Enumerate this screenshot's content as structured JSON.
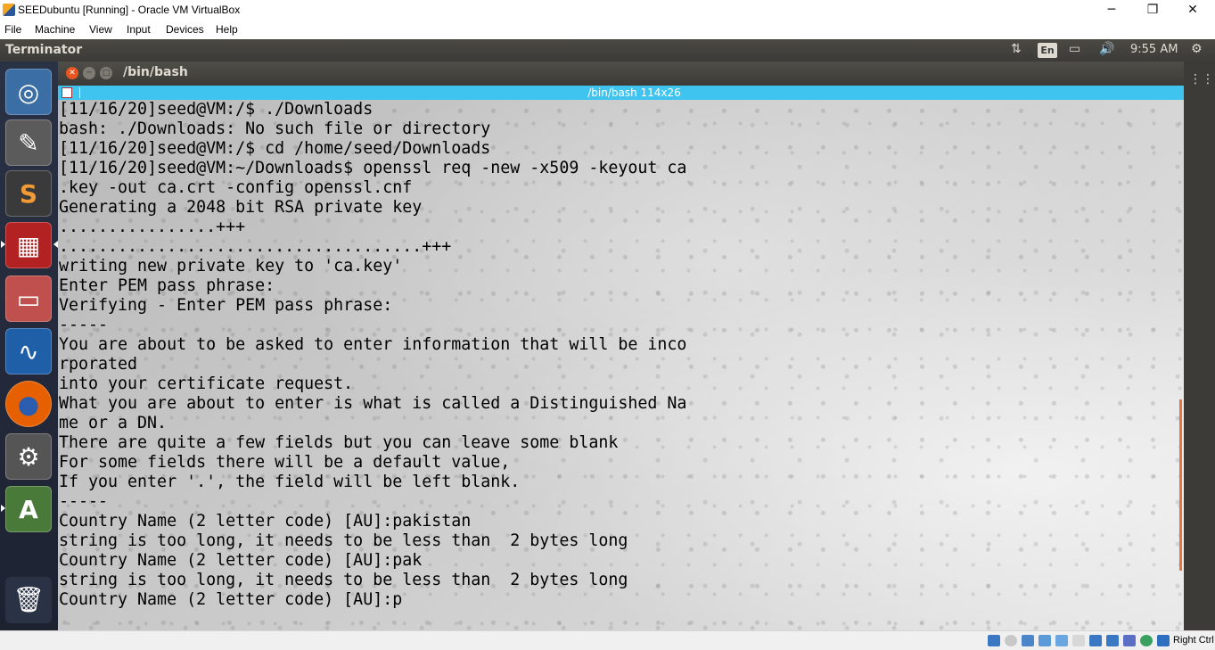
{
  "host_window": {
    "title": "SEEDubuntu [Running] - Oracle VM VirtualBox",
    "controls": {
      "minimize": "─",
      "maximize": "❐",
      "close": "✕"
    }
  },
  "host_menu": [
    "File",
    "Machine",
    "View",
    "Input",
    "Devices",
    "Help"
  ],
  "ubuntu_panel": {
    "app_name": "Terminator",
    "keyboard_layout": "En",
    "clock": "9:55 AM",
    "icons": [
      "network-transfer-icon",
      "battery-icon",
      "volume-icon",
      "settings-gear-icon"
    ]
  },
  "launcher": {
    "items": [
      {
        "name": "ubuntu-dash-icon",
        "glyph": "◎",
        "bg": "#3b6ea5"
      },
      {
        "name": "text-editor-icon",
        "glyph": "✎",
        "bg": "#5b5b5b"
      },
      {
        "name": "sublime-text-icon",
        "glyph": "S",
        "bg": "#3a3a3a"
      },
      {
        "name": "terminator-icon",
        "glyph": "▦",
        "bg": "#b22222"
      },
      {
        "name": "file-manager-icon",
        "glyph": "▭",
        "bg": "#c0504d"
      },
      {
        "name": "wireshark-icon",
        "glyph": "∿",
        "bg": "#1f5fa8"
      },
      {
        "name": "firefox-icon",
        "glyph": "●",
        "bg": "#e66000"
      },
      {
        "name": "system-settings-icon",
        "glyph": "⚙",
        "bg": "#555555"
      },
      {
        "name": "software-updater-icon",
        "glyph": "A",
        "bg": "#4a7a3a"
      },
      {
        "name": "trash-icon",
        "glyph": "🗑",
        "bg": "#2a3246"
      }
    ]
  },
  "terminal": {
    "window_title": "/bin/bash",
    "tab_title": "/bin/bash 114x26",
    "lines": [
      "[11/16/20]seed@VM:/$ ./Downloads",
      "bash: ./Downloads: No such file or directory",
      "[11/16/20]seed@VM:/$ cd /home/seed/Downloads",
      "[11/16/20]seed@VM:~/Downloads$ openssl req -new -x509 -keyout ca",
      ".key -out ca.crt -config openssl.cnf",
      "Generating a 2048 bit RSA private key",
      "................+++",
      ".....................................+++",
      "writing new private key to 'ca.key'",
      "Enter PEM pass phrase:",
      "Verifying - Enter PEM pass phrase:",
      "-----",
      "You are about to be asked to enter information that will be inco",
      "rporated",
      "into your certificate request.",
      "What you are about to enter is what is called a Distinguished Na",
      "me or a DN.",
      "There are quite a few fields but you can leave some blank",
      "For some fields there will be a default value,",
      "If you enter '.', the field will be left blank.",
      "-----",
      "Country Name (2 letter code) [AU]:pakistan",
      "string is too long, it needs to be less than  2 bytes long",
      "Country Name (2 letter code) [AU]:pak",
      "string is too long, it needs to be less than  2 bytes long",
      "Country Name (2 letter code) [AU]:p"
    ]
  },
  "host_status": {
    "host_key": "Right Ctrl"
  },
  "colors": {
    "tab_accent": "#3fc4f0",
    "scrollbar": "#e8753b",
    "panel": "#3c3b37"
  }
}
